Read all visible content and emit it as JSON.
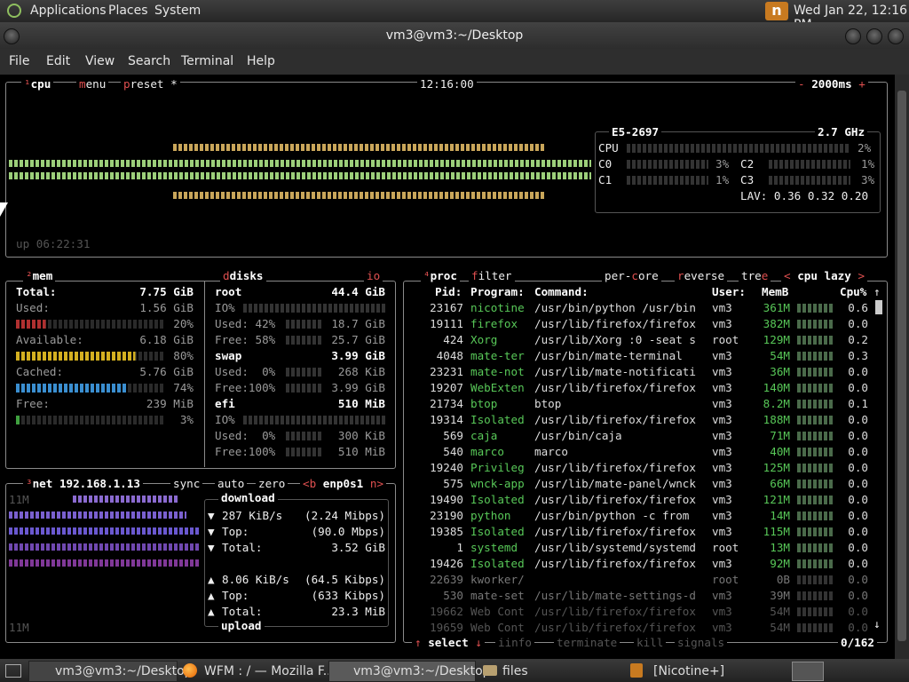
{
  "top_panel": {
    "menus": [
      "Applications",
      "Places",
      "System"
    ],
    "clock": "Wed Jan 22, 12:16 PM"
  },
  "window": {
    "title": "vm3@vm3:~/Desktop"
  },
  "menu": [
    "File",
    "Edit",
    "View",
    "Search",
    "Terminal",
    "Help"
  ],
  "cpu": {
    "tabs": [
      "cpu",
      "menu",
      "preset"
    ],
    "preset_mark": "*",
    "clock": "12:16:00",
    "rate": "2000ms",
    "model": "E5-2697",
    "freq": "2.7 GHz",
    "total_label": "CPU",
    "total_pct": "2%",
    "cores": [
      {
        "name": "C0",
        "pct": "3%"
      },
      {
        "name": "C2",
        "pct": "1%"
      },
      {
        "name": "C1",
        "pct": "1%"
      },
      {
        "name": "C3",
        "pct": "3%"
      }
    ],
    "lav": "LAV: 0.36 0.32 0.20",
    "uptime": "up 06:22:31"
  },
  "mem": {
    "title": "mem",
    "rows": [
      [
        "Total:",
        "7.75 GiB"
      ],
      [
        "Used:",
        "1.56 GiB"
      ],
      [
        "",
        "20%"
      ],
      [
        "Available:",
        "6.18 GiB"
      ],
      [
        "",
        "80%"
      ],
      [
        "Cached:",
        "5.76 GiB"
      ],
      [
        "",
        "74%"
      ],
      [
        "Free:",
        "239 MiB"
      ],
      [
        "",
        "3%"
      ]
    ],
    "levels": [
      {
        "name": "used",
        "frac": 0.2
      },
      {
        "name": "available",
        "frac": 0.8
      },
      {
        "name": "cached",
        "frac": 0.74
      },
      {
        "name": "free",
        "frac": 0.03
      }
    ],
    "colors": {
      "used": "#b03030",
      "available": "#d4b020",
      "cached": "#3a8ed0",
      "free": "#3fa03f"
    }
  },
  "disks": {
    "title": "disks",
    "io_tab": "io",
    "rows": [
      [
        "root",
        "44.4 GiB"
      ],
      [
        "IO%",
        ""
      ],
      [
        "Used: 42%",
        "18.7 GiB"
      ],
      [
        "Free: 58%",
        "25.7 GiB"
      ],
      [
        "swap",
        "3.99 GiB"
      ],
      [
        "Used:  0%",
        "268 KiB"
      ],
      [
        "Free:100%",
        "3.99 GiB"
      ],
      [
        "efi",
        "510 MiB"
      ],
      [
        "IO%",
        ""
      ],
      [
        "Used:  0%",
        "300 KiB"
      ],
      [
        "Free:100%",
        "510 MiB"
      ]
    ]
  },
  "net": {
    "title": "net",
    "ip": "192.168.1.13",
    "tabs": [
      "sync",
      "auto",
      "zero"
    ],
    "prev": "<b",
    "iface": "enp0s1",
    "next": "n>",
    "scale_top": "11M",
    "scale_bottom": "11M",
    "download_label": "download",
    "upload_label": "upload",
    "down_rows": [
      [
        "287 KiB/s",
        "(2.24 Mibps)"
      ],
      [
        "Top:",
        "(90.0 Mbps)"
      ],
      [
        "Total:",
        "3.52 GiB"
      ]
    ],
    "up_rows": [
      [
        "8.06 KiB/s",
        "(64.5 Kibps)"
      ],
      [
        "Top:",
        "(633 Kibps)"
      ],
      [
        "Total:",
        "23.3 MiB"
      ]
    ]
  },
  "proc": {
    "tabs": [
      "proc",
      "filter",
      "per-core",
      "reverse",
      "tree"
    ],
    "sort_prev": "<",
    "sort": "cpu lazy",
    "sort_next": ">",
    "headers": [
      "Pid:",
      "Program:",
      "Command:",
      "User:",
      "MemB",
      "Cpu%"
    ],
    "rows": [
      [
        "23167",
        "nicotine",
        "/usr/bin/python /usr/bin",
        "vm3",
        "361M",
        "0.6"
      ],
      [
        "19111",
        "firefox",
        "/usr/lib/firefox/firefox",
        "vm3",
        "382M",
        "0.0"
      ],
      [
        "424",
        "Xorg",
        "/usr/lib/Xorg :0 -seat s",
        "root",
        "129M",
        "0.2"
      ],
      [
        "4048",
        "mate-ter",
        "/usr/bin/mate-terminal",
        "vm3",
        "54M",
        "0.3"
      ],
      [
        "23231",
        "mate-not",
        "/usr/lib/mate-notificati",
        "vm3",
        "36M",
        "0.0"
      ],
      [
        "19207",
        "WebExten",
        "/usr/lib/firefox/firefox",
        "vm3",
        "140M",
        "0.0"
      ],
      [
        "21734",
        "btop",
        "btop",
        "vm3",
        "8.2M",
        "0.1"
      ],
      [
        "19314",
        "Isolated",
        "/usr/lib/firefox/firefox",
        "vm3",
        "188M",
        "0.0"
      ],
      [
        "569",
        "caja",
        "/usr/bin/caja",
        "vm3",
        "71M",
        "0.0"
      ],
      [
        "540",
        "marco",
        "marco",
        "vm3",
        "40M",
        "0.0"
      ],
      [
        "19240",
        "Privileg",
        "/usr/lib/firefox/firefox",
        "vm3",
        "125M",
        "0.0"
      ],
      [
        "575",
        "wnck-app",
        "/usr/lib/mate-panel/wnck",
        "vm3",
        "66M",
        "0.0"
      ],
      [
        "19490",
        "Isolated",
        "/usr/lib/firefox/firefox",
        "vm3",
        "121M",
        "0.0"
      ],
      [
        "23190",
        "python",
        "/usr/bin/python -c from",
        "vm3",
        "14M",
        "0.0"
      ],
      [
        "19385",
        "Isolated",
        "/usr/lib/firefox/firefox",
        "vm3",
        "115M",
        "0.0"
      ],
      [
        "1",
        "systemd",
        "/usr/lib/systemd/systemd",
        "root",
        "13M",
        "0.0"
      ],
      [
        "19426",
        "Isolated",
        "/usr/lib/firefox/firefox",
        "vm3",
        "92M",
        "0.0"
      ],
      [
        "22639",
        "kworker/",
        "",
        "root",
        "0B",
        "0.0"
      ],
      [
        "530",
        "mate-set",
        "/usr/lib/mate-settings-d",
        "vm3",
        "39M",
        "0.0"
      ],
      [
        "19662",
        "Web Cont",
        "/usr/lib/firefox/firefox",
        "vm3",
        "54M",
        "0.0"
      ],
      [
        "19659",
        "Web Cont",
        "/usr/lib/firefox/firefox",
        "vm3",
        "54M",
        "0.0"
      ]
    ],
    "footer": {
      "select": "select",
      "info": "info",
      "terminate": "terminate",
      "kill": "kill",
      "signals": "signals",
      "count": "0/162"
    }
  },
  "taskbar": [
    "vm3@vm3:~/Desktop",
    "WFM : / — Mozilla F...",
    "vm3@vm3:~/Desktop",
    "files",
    "[Nicotine+]"
  ]
}
